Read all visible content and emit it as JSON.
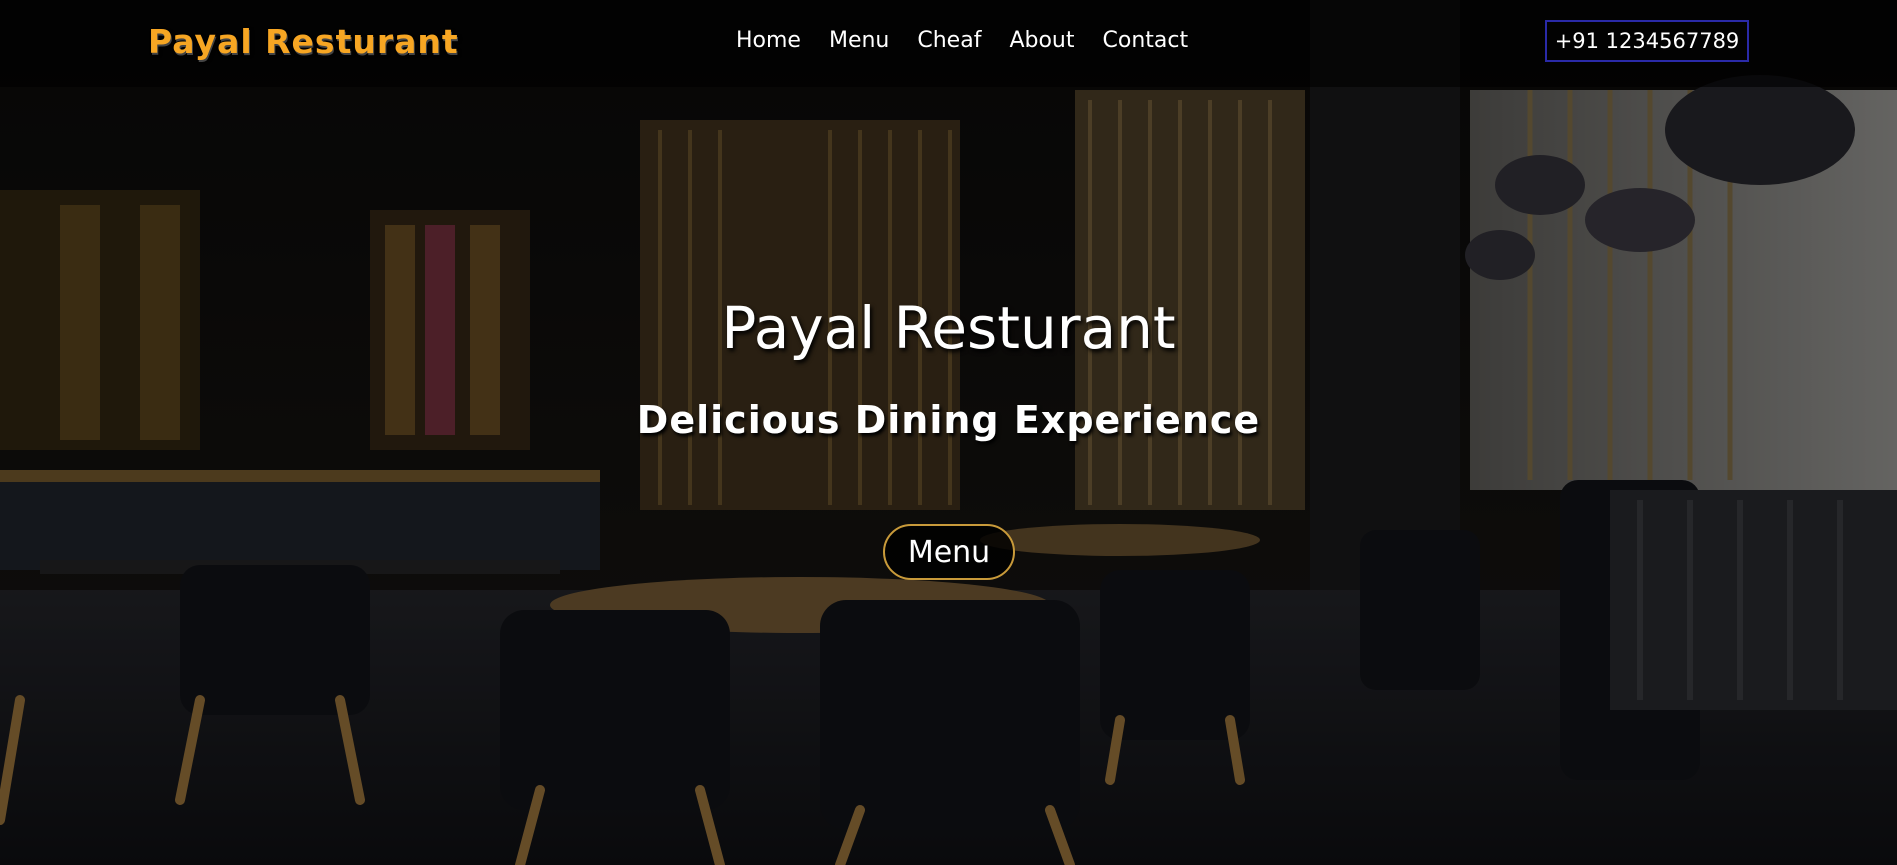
{
  "nav": {
    "brand": "Payal Resturant",
    "links": [
      "Home",
      "Menu",
      "Cheaf",
      "About",
      "Contact"
    ],
    "phone": "+91 1234567789"
  },
  "hero": {
    "title": "Payal Resturant",
    "subtitle": "Delicious Dining Experience",
    "button_label": "Menu",
    "background": "restaurant-interior-image"
  },
  "colors": {
    "brand": "#f7a623",
    "phone_border": "#2a2aa8",
    "button_border": "#c89a3a",
    "text": "#ffffff"
  }
}
